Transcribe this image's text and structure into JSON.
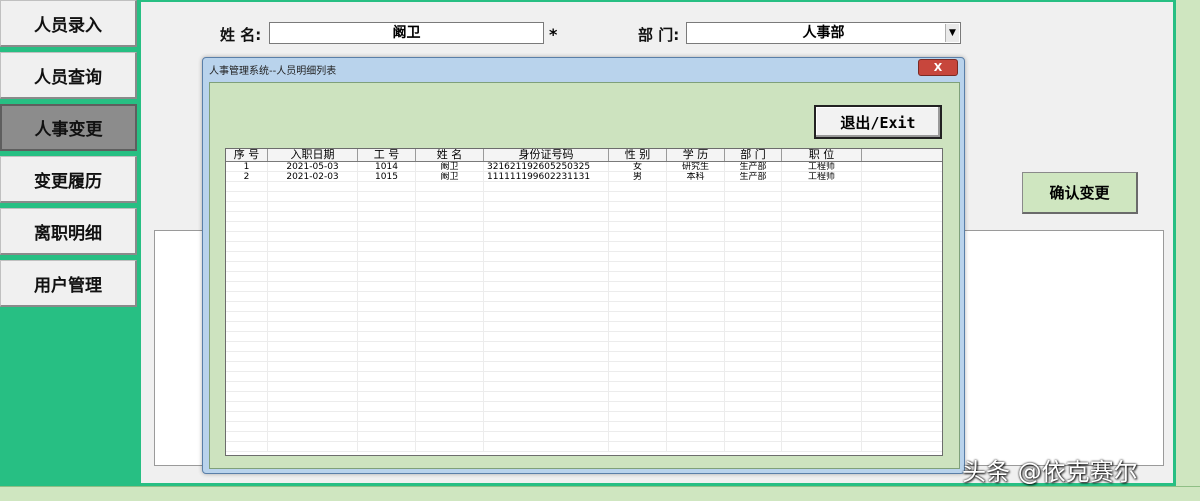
{
  "sidebar": {
    "items": [
      {
        "label": "人员录入",
        "active": false
      },
      {
        "label": "人员查询",
        "active": false
      },
      {
        "label": "人事变更",
        "active": true
      },
      {
        "label": "变更履历",
        "active": false
      },
      {
        "label": "离职明细",
        "active": false
      },
      {
        "label": "用户管理",
        "active": false
      }
    ]
  },
  "form": {
    "name_label": "姓 名:",
    "name_value": "阚卫",
    "required_mark": "*",
    "dept_label": "部 门:",
    "dept_value": "人事部",
    "confirm_label": "确认变更"
  },
  "dialog": {
    "title": "人事管理系统--人员明细列表",
    "close_label": "X",
    "exit_label": "退出/Exit",
    "columns": [
      "序 号",
      "入职日期",
      "工 号",
      "姓 名",
      "身份证号码",
      "性 别",
      "学 历",
      "部 门",
      "职 位"
    ],
    "rows": [
      [
        "1",
        "2021-05-03",
        "1014",
        "阚卫",
        "321621192605250325",
        "女",
        "研究生",
        "生产部",
        "工程师"
      ],
      [
        "2",
        "2021-02-03",
        "1015",
        "阚卫",
        "111111199602231131",
        "男",
        "本科",
        "生产部",
        "工程师"
      ]
    ]
  },
  "watermark": "头条 @依克赛尔",
  "colors": {
    "sidebar_bg": "#27bf83",
    "dialog_body": "#cde3bf",
    "active_item": "#8c8c8c",
    "close_button": "#c7463c"
  }
}
